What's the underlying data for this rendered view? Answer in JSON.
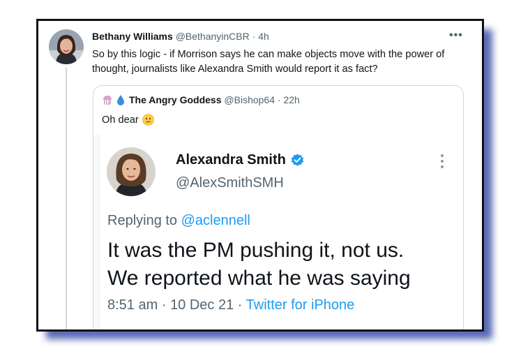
{
  "tweet": {
    "author_name": "Bethany Williams",
    "author_handle": "@BethanyinCBR",
    "separator": "·",
    "time": "4h",
    "more": "•••",
    "text": "So by this logic - if Morrison says he can make objects move with the power of thought, journalists like Alexandra Smith would report it as fact?"
  },
  "quote": {
    "author_name": "The Angry Goddess",
    "author_handle": "@Bishop64",
    "separator": "·",
    "time": "22h",
    "text": "Oh dear",
    "name_icons": [
      "jellyfish-emoji-icon",
      "droplet-emoji-icon"
    ],
    "text_emoji": "confused-face-emoji-icon"
  },
  "embedded": {
    "author_name": "Alexandra Smith",
    "author_handle": "@AlexSmithSMH",
    "verified": true,
    "replying_prefix": "Replying to",
    "replying_to": "@aclennell",
    "body_line1": "It was the PM pushing it, not us.",
    "body_line2": "We reported what he was saying",
    "time": "8:51 am",
    "date": "10 Dec 21",
    "separator": "·",
    "source": "Twitter for iPhone"
  },
  "colors": {
    "accent": "#1d9bf0",
    "text": "#0f1419",
    "muted": "#536471",
    "frame_border": "#111111",
    "shadow": "#3d4ea8"
  }
}
